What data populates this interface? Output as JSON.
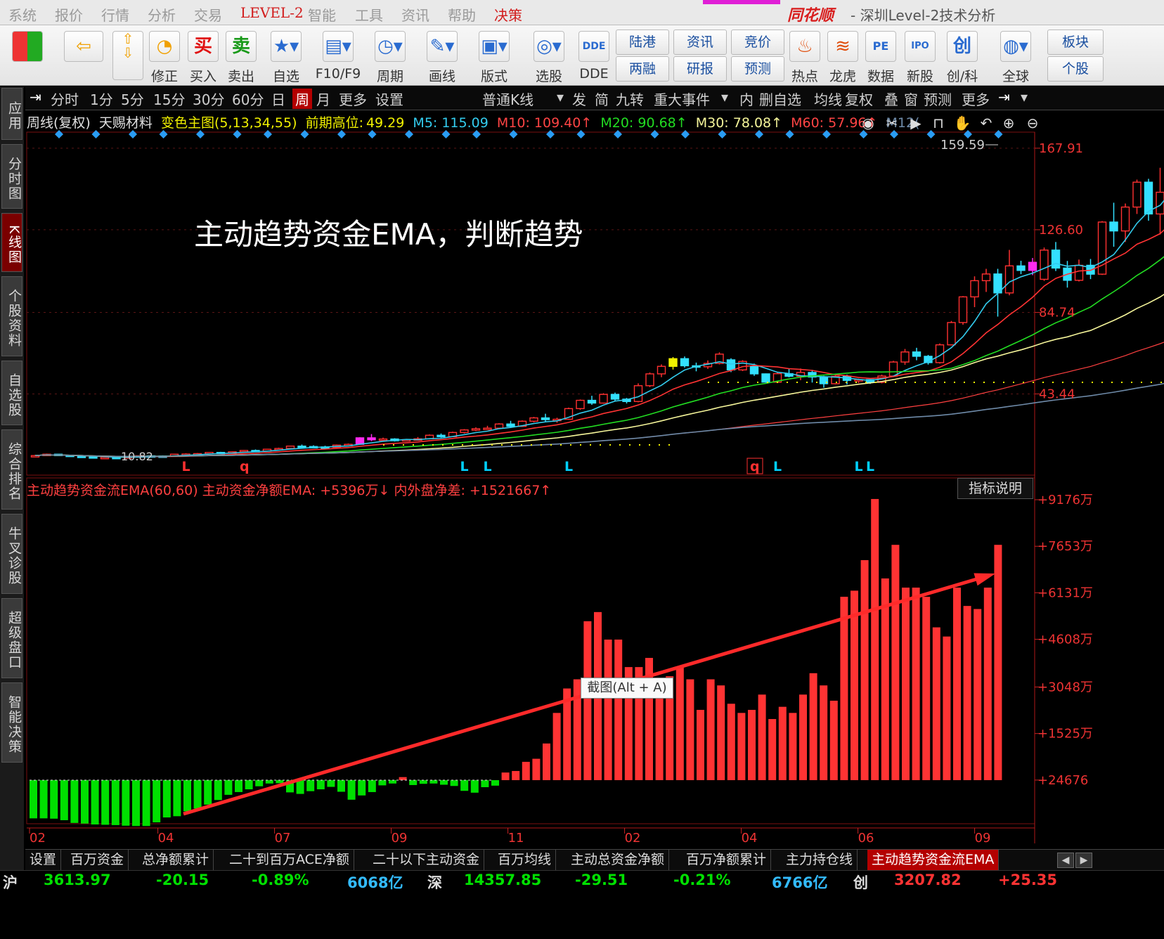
{
  "menu": {
    "items": [
      "系统",
      "报价",
      "行情",
      "分析",
      "交易",
      "LEVEL-2",
      "智能",
      "工具",
      "资讯",
      "帮助",
      "决策"
    ],
    "logo": "同花顺",
    "title": "- 深圳Level-2技术分析"
  },
  "toolbar": {
    "buttons": [
      {
        "icon": "multi-window-icon",
        "label": ""
      },
      {
        "icon": "back-arrow-icon",
        "label": ""
      },
      {
        "icon": "up-down-arrows-icon",
        "label": ""
      },
      {
        "icon": "correct-icon",
        "label": "修正"
      },
      {
        "icon": "buy-icon",
        "label": "买入",
        "glyph": "买"
      },
      {
        "icon": "sell-icon",
        "label": "卖出",
        "glyph": "卖"
      },
      {
        "icon": "watchlist-icon",
        "label": "自选"
      },
      {
        "icon": "f10-icon",
        "label": "F10/F9"
      },
      {
        "icon": "period-icon",
        "label": "周期"
      },
      {
        "icon": "draw-line-icon",
        "label": "画线"
      },
      {
        "icon": "layout-icon",
        "label": "版式"
      },
      {
        "icon": "stock-picker-icon",
        "label": "选股"
      },
      {
        "icon": "dde-icon",
        "label": "DDE",
        "glyph": "DDE"
      },
      {
        "icon": "hot-icon",
        "label": "热点"
      },
      {
        "icon": "dragon-tiger-icon",
        "label": "龙虎"
      },
      {
        "icon": "pe-data-icon",
        "label": "数据",
        "glyph": "PE"
      },
      {
        "icon": "ipo-icon",
        "label": "新股",
        "glyph": "IPO"
      },
      {
        "icon": "chuangke-icon",
        "label": "创/科",
        "glyph": "创"
      },
      {
        "icon": "globe-icon",
        "label": "全球"
      }
    ],
    "pairs": [
      {
        "top": "陆港",
        "bottom": "两融"
      },
      {
        "top": "资讯",
        "bottom": "研报"
      },
      {
        "top": "竞价",
        "bottom": "预测"
      },
      {
        "top": "板块",
        "bottom": "个股"
      }
    ]
  },
  "sidebar": {
    "items": [
      "应用",
      "分时图",
      "K线图",
      "个股资料",
      "自选股",
      "综合排名",
      "牛叉诊股",
      "超级盘口",
      "智能决策"
    ],
    "active_index": 2
  },
  "periodbar": {
    "periods": [
      "分时",
      "1分",
      "5分",
      "15分",
      "30分",
      "60分",
      "日",
      "周",
      "月",
      "更多",
      "设置"
    ],
    "selected": "周",
    "kline_type": "普通K线",
    "right_items": [
      "发",
      "简",
      "九转",
      "重大事件",
      "内",
      "删自选",
      "均线",
      "复权",
      "叠",
      "窗",
      "预测",
      "更多"
    ]
  },
  "kline": {
    "header": {
      "period": "周线(复权)",
      "stock": "天赐材料",
      "main_indicator": "变色主图(5,13,34,55)",
      "prev_high_label": "前期高位:",
      "prev_high_value": "49.29",
      "m5": "M5: 115.09",
      "m10": "M10: 109.40↑",
      "m20": "M20: 90.68↑",
      "m30": "M30: 78.08↑",
      "m60": "M60: 57.96↑",
      "m120": "M12("
    },
    "y_ticks": [
      "167.91",
      "126.60",
      "84.74",
      "43.44"
    ],
    "y_tick_values": [
      167.91,
      126.6,
      84.74,
      43.44
    ],
    "high_label": "159.59",
    "low_label": "10.82",
    "annotation": "主动趋势资金EMA，判断趋势",
    "signal_marks": [
      {
        "text": "L",
        "color": "#ff3030"
      },
      {
        "text": "q",
        "color": "#ff3030"
      },
      {
        "text": "L",
        "color": "#00d0ff"
      },
      {
        "text": "L",
        "color": "#00d0ff"
      },
      {
        "text": "L",
        "color": "#00d0ff"
      },
      {
        "text": "q",
        "color": "#ff3030"
      },
      {
        "text": "L",
        "color": "#00d0ff"
      },
      {
        "text": "L",
        "color": "#00d0ff"
      },
      {
        "text": "L",
        "color": "#00d0ff"
      }
    ]
  },
  "indicator": {
    "name": "主动趋势资金流EMA(60,60)",
    "net_label": "主动资金净额EMA:",
    "net_value": "+5396万↓",
    "diff_label": "内外盘净差:",
    "diff_value": "+1521667↑",
    "help_button": "指标说明",
    "y_ticks": [
      "+9176万",
      "+7653万",
      "+6131万",
      "+4608万",
      "+3048万",
      "+1525万",
      "+24676"
    ],
    "y_tick_values": [
      9176,
      7653,
      6131,
      4608,
      3048,
      1525,
      2.4676
    ],
    "screenshot_tip": "截图(Alt + A)"
  },
  "x_axis": {
    "ticks": [
      "02",
      "04",
      "07",
      "09",
      "11",
      "02",
      "04",
      "06",
      "09"
    ],
    "tick_bar_index": [
      0,
      11,
      21,
      31,
      41,
      51,
      61,
      71,
      81
    ]
  },
  "chart_data": [
    {
      "type": "candlestick",
      "title": "周线(复权) 天赐材料",
      "y_range": [
        8,
        170
      ],
      "ohlc": [
        [
          12,
          12.6,
          11.8,
          12.2
        ],
        [
          12.2,
          13.2,
          12,
          12.9
        ],
        [
          12.9,
          13,
          12.3,
          12.4
        ],
        [
          12.4,
          12.6,
          11.7,
          11.9
        ],
        [
          11.9,
          12.2,
          11.3,
          11.6
        ],
        [
          11.6,
          11.9,
          10.9,
          11.2
        ],
        [
          11.2,
          11.5,
          10.8,
          11.3
        ],
        [
          11.3,
          11.6,
          10.9,
          11.1
        ],
        [
          11.1,
          11.8,
          11,
          11.6
        ],
        [
          11.6,
          12.3,
          11.4,
          12.1
        ],
        [
          12.1,
          12.4,
          11.8,
          12
        ],
        [
          12,
          12.3,
          11.6,
          11.8
        ],
        [
          11.8,
          13.1,
          11.7,
          12.9
        ],
        [
          12.9,
          13.4,
          12.6,
          13
        ],
        [
          13,
          13.5,
          12.8,
          13.2
        ],
        [
          13.2,
          14,
          13,
          13.8
        ],
        [
          13.8,
          14.1,
          13.2,
          13.4
        ],
        [
          13.4,
          14.3,
          13.3,
          14.1
        ],
        [
          14.1,
          15,
          13.9,
          14.8
        ],
        [
          14.8,
          15.3,
          14.2,
          14.5
        ],
        [
          14.5,
          15.6,
          14.4,
          15.4
        ],
        [
          15.4,
          16.2,
          15,
          15.8
        ],
        [
          15.8,
          17.2,
          15.6,
          17
        ],
        [
          17,
          17.8,
          16.4,
          16.8
        ],
        [
          16.8,
          17.4,
          16.1,
          16.6
        ],
        [
          16.6,
          17.2,
          16,
          16.4
        ],
        [
          16.4,
          17.8,
          16.3,
          17.5
        ],
        [
          17.5,
          18.3,
          17,
          17.9
        ],
        [
          17.9,
          21.5,
          17.6,
          21.2
        ],
        [
          21.2,
          23.1,
          19.5,
          20.2
        ],
        [
          20.2,
          21.3,
          19.4,
          20.6
        ],
        [
          20.6,
          21,
          19.3,
          19.7
        ],
        [
          19.7,
          20.5,
          19.4,
          20.3
        ],
        [
          20.3,
          21.6,
          19.8,
          20.7
        ],
        [
          20.7,
          22.9,
          20.4,
          22.5
        ],
        [
          22.5,
          23.4,
          21.3,
          21.8
        ],
        [
          21.8,
          24.3,
          21.6,
          23.9
        ],
        [
          23.9,
          25.6,
          23.4,
          25.2
        ],
        [
          25.2,
          26.5,
          24.6,
          25.8
        ],
        [
          25.8,
          27.3,
          25.3,
          26.1
        ],
        [
          26.1,
          28.6,
          25.8,
          28.2
        ],
        [
          28.2,
          29.8,
          26.6,
          27
        ],
        [
          27,
          30,
          26.8,
          29.6
        ],
        [
          29.6,
          31.8,
          29,
          31.3
        ],
        [
          31.3,
          33.4,
          29.5,
          30.4
        ],
        [
          30.4,
          31.4,
          28.8,
          30.6
        ],
        [
          30.6,
          36.5,
          30.3,
          36
        ],
        [
          36,
          40.6,
          35.4,
          40.2
        ],
        [
          40.2,
          42.5,
          37.9,
          38.8
        ],
        [
          38.8,
          43.8,
          38.5,
          43.2
        ],
        [
          43.2,
          44.1,
          39.8,
          40.8
        ],
        [
          40.8,
          41.4,
          38.6,
          39.6
        ],
        [
          39.6,
          48.8,
          39.2,
          47.6
        ],
        [
          47.6,
          54.3,
          46.9,
          53.6
        ],
        [
          53.6,
          58.4,
          51.9,
          57.4
        ],
        [
          57.4,
          62.1,
          55.8,
          61.3
        ],
        [
          61.3,
          62.4,
          56.8,
          57.7
        ],
        [
          57.7,
          59.3,
          54.9,
          57.2
        ],
        [
          57.2,
          60.4,
          56.1,
          58.9
        ],
        [
          58.9,
          64.5,
          58.4,
          63.6
        ],
        [
          60.7,
          61.5,
          54.5,
          55.6
        ],
        [
          55.6,
          60.5,
          55,
          59.9
        ],
        [
          57.4,
          58.8,
          52.6,
          53.6
        ],
        [
          53.6,
          53.8,
          49.1,
          49.4
        ],
        [
          49.4,
          54.4,
          49,
          53.7
        ],
        [
          53.7,
          56.2,
          51.8,
          52.4
        ],
        [
          52.4,
          56.3,
          50.4,
          54.3
        ],
        [
          54.3,
          55.6,
          49.2,
          52
        ],
        [
          52,
          52.6,
          46.6,
          48.6
        ],
        [
          48.6,
          52.9,
          48.3,
          52.4
        ],
        [
          52.4,
          53.2,
          48.2,
          50.3
        ],
        [
          50.3,
          51.2,
          48.9,
          50.7
        ],
        [
          50.7,
          50.9,
          48.5,
          49.3
        ],
        [
          49.3,
          53.2,
          48.8,
          52.5
        ],
        [
          52.5,
          60.2,
          52.3,
          59.6
        ],
        [
          59.6,
          66.2,
          58.2,
          64.7
        ],
        [
          64.7,
          66.8,
          60.5,
          62.5
        ],
        [
          62.5,
          63.2,
          58.3,
          59.3
        ],
        [
          59.3,
          69,
          58.8,
          68.3
        ],
        [
          68.3,
          80.4,
          68,
          79.6
        ],
        [
          79.6,
          93,
          78.5,
          92.6
        ],
        [
          92.6,
          103,
          87.4,
          100.8
        ],
        [
          100.8,
          106.8,
          95.1,
          104.2
        ],
        [
          104.2,
          106.8,
          82.6,
          94.6
        ],
        [
          94.6,
          116.4,
          93.4,
          108.3
        ],
        [
          108.3,
          110.9,
          104.1,
          106
        ],
        [
          106,
          112.3,
          103.6,
          110.1
        ],
        [
          101.5,
          117.6,
          100.7,
          116.3
        ],
        [
          116.3,
          120.4,
          105.7,
          107.2
        ],
        [
          107.2,
          110.8,
          97.3,
          101
        ],
        [
          101,
          111.5,
          100.4,
          108.6
        ],
        [
          108.6,
          111.8,
          101.6,
          104.1
        ],
        [
          104.1,
          131,
          103.7,
          130.5
        ],
        [
          130.5,
          140.3,
          118,
          126
        ],
        [
          126,
          139.9,
          120.4,
          138.1
        ],
        [
          138.1,
          152,
          134.6,
          150.7
        ],
        [
          150.7,
          152.4,
          131.2,
          134.6
        ],
        [
          134.6,
          158,
          124.2,
          145.6
        ],
        [
          145.6,
          167.9,
          145.1,
          161.4
        ],
        [
          161.4,
          163.5,
          141,
          158.2
        ]
      ],
      "prev_high": 49.29,
      "ma": [
        {
          "name": "M5",
          "color": "#33ccee",
          "values": [
            115.09
          ]
        },
        {
          "name": "M10",
          "color": "#ff3333",
          "values": [
            109.4
          ]
        },
        {
          "name": "M20",
          "color": "#22dd22",
          "values": [
            90.68
          ]
        },
        {
          "name": "M30",
          "color": "#f5f59a",
          "values": [
            78.08
          ]
        },
        {
          "name": "M60",
          "color": "#ff4040",
          "values": [
            57.96
          ]
        }
      ]
    },
    {
      "type": "bar",
      "title": "主动趋势资金流EMA(60,60)",
      "ylabel": "万",
      "y_range": [
        -1500,
        9300
      ],
      "values": [
        -1250,
        -1250,
        -1260,
        -1310,
        -1400,
        -1420,
        -1450,
        -1460,
        -1470,
        -1490,
        -1500,
        -1500,
        -1380,
        -1220,
        -1180,
        -1020,
        -930,
        -800,
        -650,
        -480,
        -390,
        -300,
        -200,
        -110,
        -100,
        -400,
        -450,
        -360,
        -300,
        -220,
        -380,
        -640,
        -500,
        -390,
        -170,
        -110,
        100,
        -160,
        -120,
        -110,
        -150,
        -190,
        -350,
        -410,
        -230,
        -180,
        250,
        300,
        600,
        700,
        1200,
        2200,
        3000,
        3300,
        5200,
        5500,
        4600,
        4600,
        3700,
        3700,
        4000,
        3200,
        3400,
        3700,
        3300,
        2300,
        3300,
        3100,
        2500,
        2200,
        2300,
        2800,
        2000,
        2400,
        2200,
        2800,
        3500,
        3100,
        2600,
        6000,
        6200,
        7200,
        9200,
        6600,
        7700,
        6300,
        6300,
        6000,
        5000,
        4700,
        6300,
        5700,
        5600,
        6300,
        7700
      ],
      "colors": {
        "positive": "#ff3333",
        "negative": "#00e000"
      },
      "trend_arrow": {
        "from_bar": 15,
        "from_value": 1200,
        "to_bar": 98,
        "to_value": 6900
      }
    }
  ],
  "tabs": {
    "items": [
      "设置",
      "百万资金",
      "总净额累计",
      "二十到百万ACE净额",
      "二十以下主动资金",
      "百万均线",
      "主动总资金净额",
      "百万净额累计",
      "主力持仓线",
      "主动趋势资金流EMA"
    ],
    "selected_index": 9
  },
  "status": [
    {
      "text": "沪",
      "color": "#dddddd"
    },
    {
      "text": "3613.97",
      "color": "#00e000"
    },
    {
      "text": "-20.15",
      "color": "#00e000"
    },
    {
      "text": "-0.89%",
      "color": "#00e000"
    },
    {
      "text": "6068亿",
      "color": "#33bbff"
    },
    {
      "text": "深",
      "color": "#dddddd"
    },
    {
      "text": "14357.85",
      "color": "#00e000"
    },
    {
      "text": "-29.51",
      "color": "#00e000"
    },
    {
      "text": "-0.21%",
      "color": "#00e000"
    },
    {
      "text": "6766亿",
      "color": "#33bbff"
    },
    {
      "text": "创",
      "color": "#dddddd"
    },
    {
      "text": "3207.82",
      "color": "#ff3333"
    },
    {
      "text": "+25.35",
      "color": "#ff3333"
    }
  ]
}
